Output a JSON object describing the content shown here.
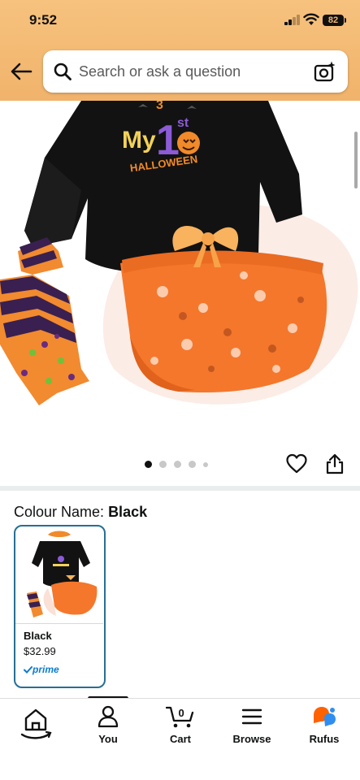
{
  "status_bar": {
    "time": "9:52",
    "battery": "82"
  },
  "search": {
    "placeholder": "Search or ask a question"
  },
  "product": {
    "print_text_top": "My 1st",
    "print_text_bottom": "HALLOWEEN",
    "image_dots": 5,
    "active_dot": 1
  },
  "colour": {
    "label": "Colour Name:",
    "value": "Black",
    "options": [
      {
        "name": "Black",
        "price": "$32.99",
        "badge": "prime"
      }
    ]
  },
  "nav": {
    "items": [
      {
        "label": "",
        "icon": "home-icon"
      },
      {
        "label": "You",
        "icon": "person-icon"
      },
      {
        "label": "Cart",
        "icon": "cart-icon",
        "count": "0"
      },
      {
        "label": "Browse",
        "icon": "menu-icon"
      },
      {
        "label": "Rufus",
        "icon": "rufus-icon"
      }
    ]
  },
  "colors": {
    "header_bg": "#f2b66e",
    "accent": "#266f95",
    "prime": "#0b7ccf",
    "rufus_orange": "#ff6200",
    "rufus_blue": "#2f8ef0"
  }
}
